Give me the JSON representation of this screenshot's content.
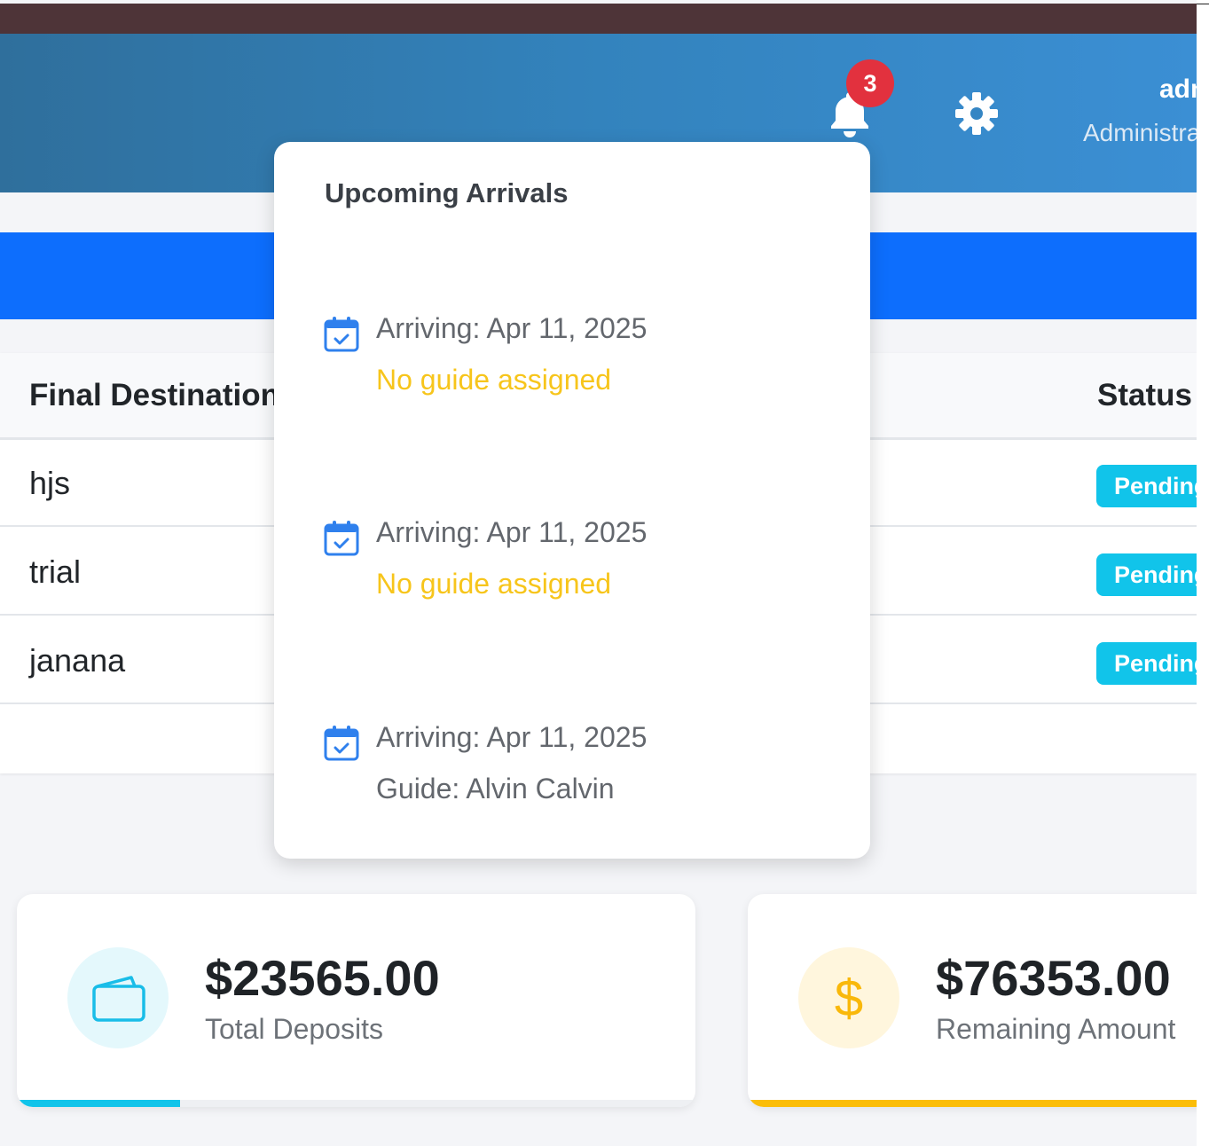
{
  "header": {
    "notification_count": "3",
    "user_name": "admin",
    "user_role": "Administrator",
    "icons": [
      "bell-icon",
      "gear-icon"
    ]
  },
  "table": {
    "columns": {
      "destination": "Final Destination",
      "status": "Status"
    },
    "rows": [
      {
        "destination": "hjs",
        "status": "Pending"
      },
      {
        "destination": "trial",
        "status": "Pending"
      },
      {
        "destination": "janana",
        "status": "Pending"
      }
    ]
  },
  "popover": {
    "title": "Upcoming Arrivals",
    "items": [
      {
        "date_text": "Arriving: Apr 11, 2025",
        "guide_text": "No guide assigned",
        "guide_assigned": false
      },
      {
        "date_text": "Arriving: Apr 11, 2025",
        "guide_text": "No guide assigned",
        "guide_assigned": false
      },
      {
        "date_text": "Arriving: Apr 11, 2025",
        "guide_text": "Guide: Alvin Calvin",
        "guide_assigned": true
      }
    ]
  },
  "stats": [
    {
      "value": "$23565.00",
      "label": "Total Deposits",
      "icon": "wallet-icon",
      "progress": 0.24
    },
    {
      "value": "$76353.00",
      "label": "Remaining Amount",
      "icon": "dollar-icon",
      "progress": 1.0
    }
  ],
  "colors": {
    "header_start": "#2f6f9c",
    "header_end": "#3b8fd4",
    "primary": "#0d6efd",
    "badge_red": "#e2313e",
    "pending_cyan": "#11c4ea",
    "warning_yellow": "#f7c51b"
  }
}
